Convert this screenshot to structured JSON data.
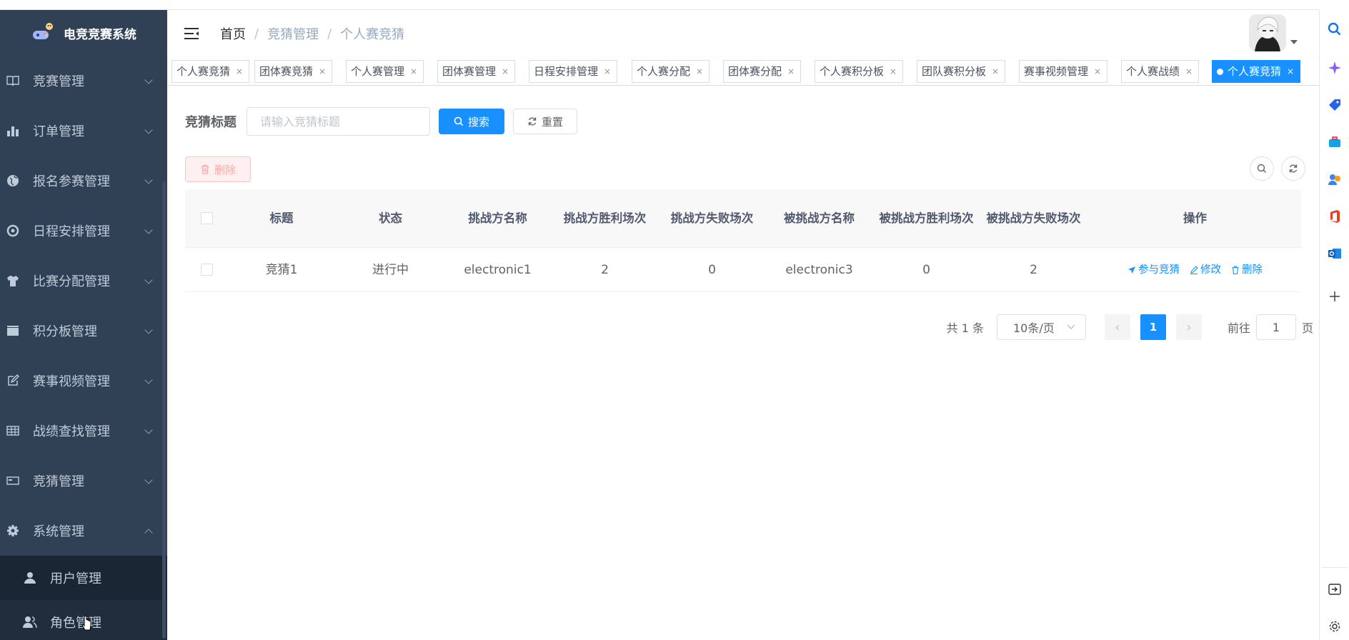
{
  "app": {
    "title": "电竞竞赛系统"
  },
  "sidebar": {
    "items": [
      {
        "label": "竞赛管理",
        "icon": "book-icon"
      },
      {
        "label": "订单管理",
        "icon": "bar-chart-icon"
      },
      {
        "label": "报名参赛管理",
        "icon": "globe-icon"
      },
      {
        "label": "日程安排管理",
        "icon": "target-icon"
      },
      {
        "label": "比赛分配管理",
        "icon": "shirt-icon"
      },
      {
        "label": "积分板管理",
        "icon": "clapperboard-icon"
      },
      {
        "label": "赛事视频管理",
        "icon": "edit-icon"
      },
      {
        "label": "战绩查找管理",
        "icon": "table-icon"
      },
      {
        "label": "竞猜管理",
        "icon": "card-icon"
      },
      {
        "label": "系统管理",
        "icon": "gear-icon"
      }
    ],
    "sub_items": [
      {
        "label": "用户管理",
        "icon": "user-icon"
      },
      {
        "label": "角色管理",
        "icon": "users-icon"
      }
    ]
  },
  "breadcrumb": [
    "首页",
    "竞猜管理",
    "个人赛竞猜"
  ],
  "tabs": [
    {
      "label": "个人赛竞猜"
    },
    {
      "label": "团体赛竞猜"
    },
    {
      "label": "个人赛管理"
    },
    {
      "label": "团体赛管理"
    },
    {
      "label": "日程安排管理"
    },
    {
      "label": "个人赛分配"
    },
    {
      "label": "团体赛分配"
    },
    {
      "label": "个人赛积分板"
    },
    {
      "label": "团队赛积分板"
    },
    {
      "label": "赛事视频管理"
    },
    {
      "label": "个人赛战绩"
    },
    {
      "label": "个人赛竞猜",
      "active": true
    }
  ],
  "search": {
    "label": "竞猜标题",
    "placeholder": "请输入竞猜标题",
    "search_button": "搜索",
    "reset_button": "重置"
  },
  "toolbar": {
    "delete_button": "删除"
  },
  "table": {
    "headers": [
      "标题",
      "状态",
      "挑战方名称",
      "挑战方胜利场次",
      "挑战方失败场次",
      "被挑战方名称",
      "被挑战方胜利场次",
      "被挑战方失败场次",
      "操作"
    ],
    "rows": [
      {
        "title": "竞猜1",
        "status": "进行中",
        "challenger": "electronic1",
        "challenger_wins": "2",
        "challenger_losses": "0",
        "defender": "electronic3",
        "defender_wins": "0",
        "defender_losses": "2",
        "actions": {
          "join": "参与竞猜",
          "edit": "修改",
          "delete": "删除"
        }
      }
    ]
  },
  "pagination": {
    "total": "共 1 条",
    "page_size": "10条/页",
    "current_page": "1",
    "goto_label": "前往",
    "goto_value": "1",
    "page_suffix": "页"
  },
  "colors": {
    "sidebar_bg": "#304156",
    "submenu_bg": "#1f2d3d",
    "primary": "#1890ff",
    "danger_light": "#fef0f0"
  }
}
